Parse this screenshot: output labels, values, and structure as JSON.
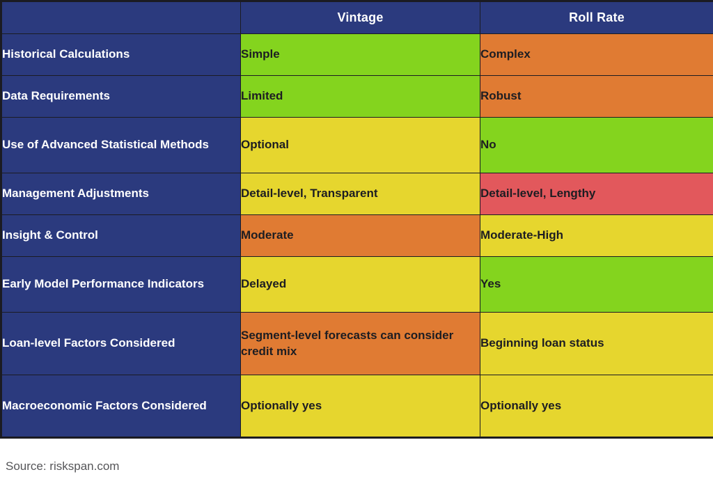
{
  "table": {
    "header": {
      "criteria_label": "",
      "columns": [
        "Vintage",
        "Roll Rate"
      ]
    },
    "rows": [
      {
        "criteria": "Historical Calculations",
        "vintage": {
          "text": "Simple",
          "color": "#84d41e",
          "swatch": "green"
        },
        "rollrate": {
          "text": "Complex",
          "color": "#e07b33",
          "swatch": "orange"
        }
      },
      {
        "criteria": "Data Requirements",
        "vintage": {
          "text": "Limited",
          "color": "#84d41e",
          "swatch": "green"
        },
        "rollrate": {
          "text": "Robust",
          "color": "#e07b33",
          "swatch": "orange"
        }
      },
      {
        "criteria": "Use of Advanced Statistical Methods",
        "vintage": {
          "text": "Optional",
          "color": "#e6d62e",
          "swatch": "yellow"
        },
        "rollrate": {
          "text": "No",
          "color": "#84d41e",
          "swatch": "green"
        }
      },
      {
        "criteria": "Management Adjustments",
        "vintage": {
          "text": "Detail-level, Transparent",
          "color": "#e6d62e",
          "swatch": "yellow"
        },
        "rollrate": {
          "text": "Detail-level, Lengthy",
          "color": "#e2585c",
          "swatch": "red"
        }
      },
      {
        "criteria": "Insight & Control",
        "vintage": {
          "text": "Moderate",
          "color": "#e07b33",
          "swatch": "orange"
        },
        "rollrate": {
          "text": "Moderate-High",
          "color": "#e6d62e",
          "swatch": "yellow"
        }
      },
      {
        "criteria": "Early Model Performance Indicators",
        "vintage": {
          "text": "Delayed",
          "color": "#e6d62e",
          "swatch": "yellow"
        },
        "rollrate": {
          "text": "Yes",
          "color": "#84d41e",
          "swatch": "green"
        }
      },
      {
        "criteria": "Loan-level Factors Considered",
        "vintage": {
          "text": "Segment-level forecasts can consider credit mix",
          "color": "#e07b33",
          "swatch": "orange"
        },
        "rollrate": {
          "text": "Beginning loan status",
          "color": "#e6d62e",
          "swatch": "yellow"
        }
      },
      {
        "criteria": "Macroeconomic Factors Considered",
        "vintage": {
          "text": "Optionally yes",
          "color": "#e6d62e",
          "swatch": "yellow"
        },
        "rollrate": {
          "text": "Optionally yes",
          "color": "#e6d62e",
          "swatch": "yellow"
        }
      }
    ]
  },
  "source": {
    "text": "Source: riskspan.com"
  },
  "colors": {
    "navy": "#2b3a7e",
    "green": "#84d41e",
    "yellow": "#e6d62e",
    "orange": "#e07b33",
    "red": "#e2585c",
    "border": "#1b1b22",
    "header_text": "#ffffff",
    "cell_text": "#1d1d22",
    "source_text": "#555558"
  }
}
